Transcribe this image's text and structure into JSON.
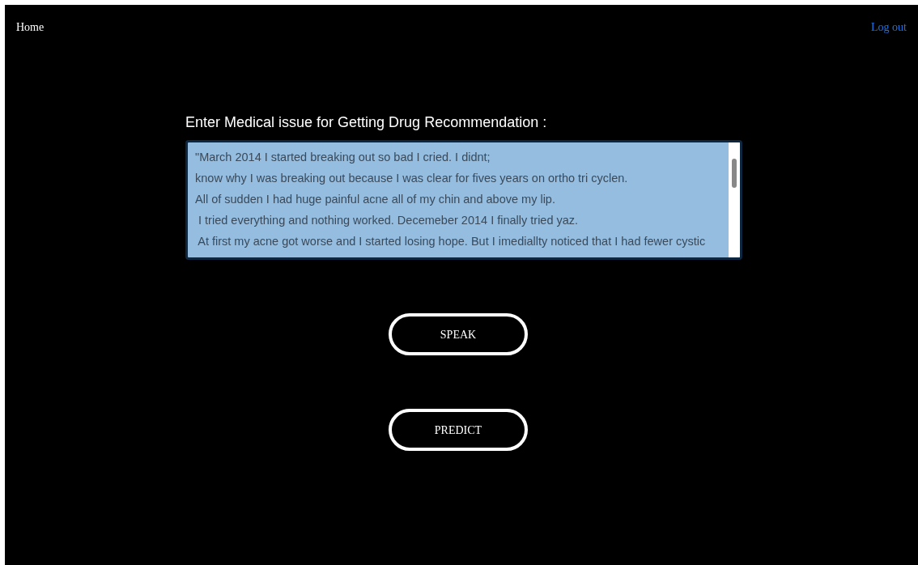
{
  "nav": {
    "home": "Home",
    "logout": "Log out"
  },
  "prompt": "Enter Medical issue for Getting Drug Recommendation :",
  "textarea": {
    "lines": [
      "\"March 2014 I started breaking out so bad I cried. I didnt;",
      "know why I was breaking out because I was clear for fives years on ortho tri cyclen.",
      "All of sudden I had huge painful acne all of my chin and above my lip.",
      " I tried everything and nothing worked. Decemeber 2014 I finally tried yaz.",
      " At first my acne got worse and I started losing hope. But I imediallty noticed that I had fewer cystic"
    ]
  },
  "buttons": [
    "SPEAK",
    "PREDICT"
  ]
}
